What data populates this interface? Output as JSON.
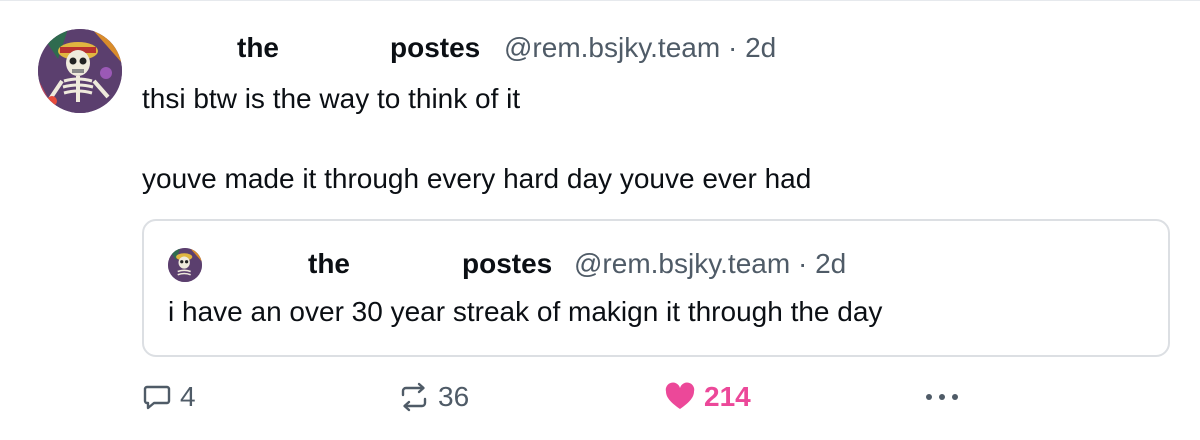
{
  "post": {
    "author_first": "the",
    "author_last": "postes",
    "handle": "@rem.bsjky.team",
    "separator": "·",
    "time": "2d",
    "text": "thsi btw is the way to think of it\n\nyouve made it through every hard day youve ever had"
  },
  "quote": {
    "author_first": "the",
    "author_last": "postes",
    "handle": "@rem.bsjky.team",
    "separator": "·",
    "time": "2d",
    "text": "i have an over 30 year streak of makign it through the day"
  },
  "actions": {
    "reply_count": "4",
    "repost_count": "36",
    "like_count": "214",
    "more_label": "···"
  },
  "icons": {
    "reply": "reply-icon",
    "repost": "repost-icon",
    "like": "heart-icon",
    "more": "more-icon"
  },
  "colors": {
    "text": "#0b0f14",
    "muted": "#4f5b67",
    "like": "#ec4899",
    "border": "#dcdfe3"
  }
}
